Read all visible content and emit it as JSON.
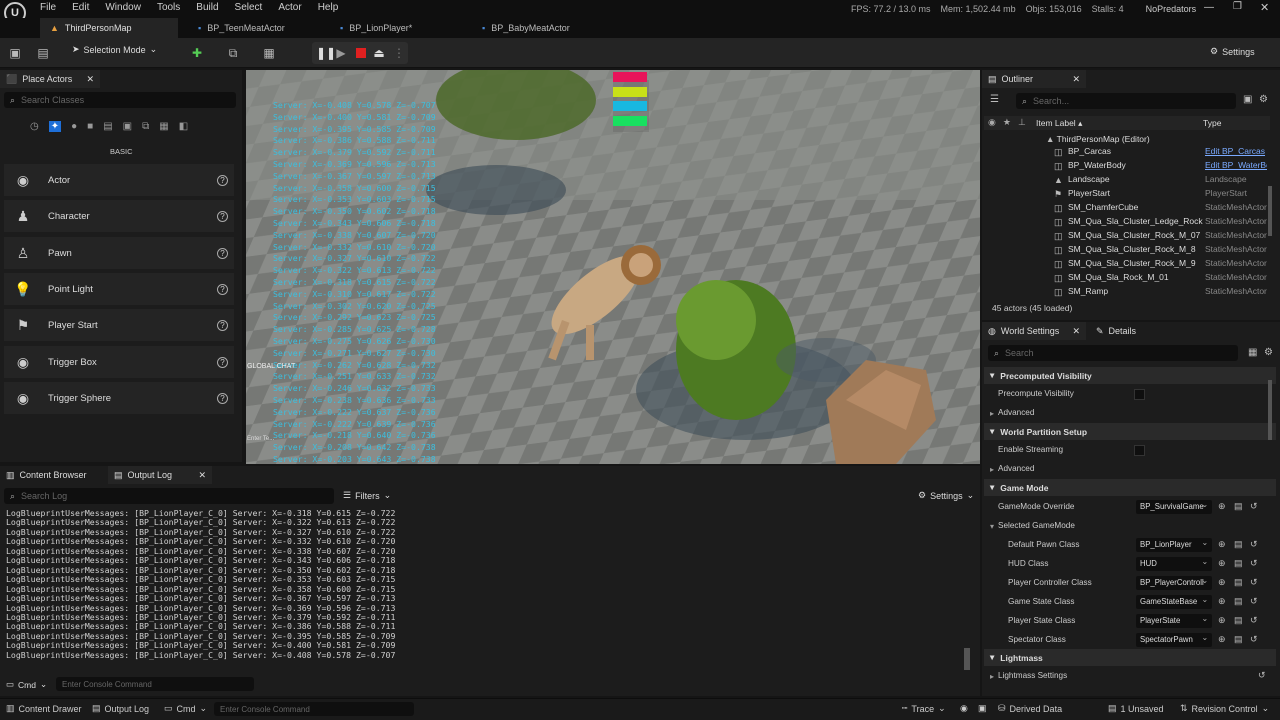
{
  "menu": [
    "File",
    "Edit",
    "Window",
    "Tools",
    "Build",
    "Select",
    "Actor",
    "Help"
  ],
  "stats": {
    "fps": "FPS: 77.2 / 13.0 ms",
    "mem": "Mem: 1,502.44 mb",
    "objs": "Objs: 153,016",
    "stalls": "Stalls: 4",
    "project": "NoPredators"
  },
  "tabs": [
    {
      "label": "ThirdPersonMap"
    },
    {
      "label": "BP_TeenMeatActor"
    },
    {
      "label": "BP_LionPlayer*"
    },
    {
      "label": "BP_BabyMeatActor"
    }
  ],
  "toolbar": {
    "mode": "Selection Mode",
    "settings": "Settings"
  },
  "place_actors": {
    "tab": "Place Actors",
    "search_placeholder": "Search Classes",
    "category": "BASIC",
    "items": [
      "Actor",
      "Character",
      "Pawn",
      "Point Light",
      "Player Start",
      "Trigger Box",
      "Trigger Sphere"
    ]
  },
  "viewport": {
    "overlay_lines": [
      "Server: X=-0.408 Y=0.578 Z=-0.707",
      "Server: X=-0.400 Y=0.581 Z=-0.709",
      "Server: X=-0.395 Y=0.585 Z=-0.709",
      "Server: X=-0.386 Y=0.588 Z=-0.711",
      "Server: X=-0.379 Y=0.592 Z=-0.711",
      "Server: X=-0.369 Y=0.596 Z=-0.713",
      "Server: X=-0.367 Y=0.597 Z=-0.713",
      "Server: X=-0.358 Y=0.600 Z=-0.715",
      "Server: X=-0.353 Y=0.603 Z=-0.715",
      "Server: X=-0.350 Y=0.602 Z=-0.718",
      "Server: X=-0.343 Y=0.606 Z=-0.718",
      "Server: X=-0.338 Y=0.607 Z=-0.720",
      "Server: X=-0.332 Y=0.610 Z=-0.720",
      "Server: X=-0.327 Y=0.610 Z=-0.722",
      "Server: X=-0.322 Y=0.613 Z=-0.722",
      "Server: X=-0.318 Y=0.615 Z=-0.722",
      "Server: X=-0.310 Y=0.617 Z=-0.722",
      "Server: X=-0.302 Y=0.620 Z=-0.725",
      "Server: X=-0.292 Y=0.623 Z=-0.725",
      "Server: X=-0.285 Y=0.625 Z=-0.728",
      "Server: X=-0.275 Y=0.626 Z=-0.730",
      "Server: X=-0.271 Y=0.627 Z=-0.730",
      "Server: X=-0.262 Y=0.628 Z=-0.732",
      "Server: X=-0.251 Y=0.633 Z=-0.732",
      "Server: X=-0.246 Y=0.632 Z=-0.733",
      "Server: X=-0.238 Y=0.636 Z=-0.733",
      "Server: X=-0.222 Y=0.637 Z=-0.736",
      "Server: X=-0.222 Y=0.639 Z=-0.736",
      "Server: X=-0.218 Y=0.640 Z=-0.736",
      "Server: X=-0.208 Y=0.642 Z=-0.738",
      "Server: X=-0.203 Y=0.643 Z=-0.738"
    ],
    "global_chat": "GLOBAL CHAT",
    "enter_text": "Enter Te...",
    "bars": [
      "#e8145a",
      "#c8e018",
      "#18b8e0",
      "#18e060"
    ]
  },
  "bottom_tabs": {
    "content_browser": "Content Browser",
    "output_log": "Output Log"
  },
  "log": {
    "search_placeholder": "Search Log",
    "filters": "Filters",
    "settings": "Settings",
    "lines": [
      "LogBlueprintUserMessages: [BP_LionPlayer_C_0] Server: X=-0.318 Y=0.615 Z=-0.722",
      "LogBlueprintUserMessages: [BP_LionPlayer_C_0] Server: X=-0.322 Y=0.613 Z=-0.722",
      "LogBlueprintUserMessages: [BP_LionPlayer_C_0] Server: X=-0.327 Y=0.610 Z=-0.722",
      "LogBlueprintUserMessages: [BP_LionPlayer_C_0] Server: X=-0.332 Y=0.610 Z=-0.720",
      "LogBlueprintUserMessages: [BP_LionPlayer_C_0] Server: X=-0.338 Y=0.607 Z=-0.720",
      "LogBlueprintUserMessages: [BP_LionPlayer_C_0] Server: X=-0.343 Y=0.606 Z=-0.718",
      "LogBlueprintUserMessages: [BP_LionPlayer_C_0] Server: X=-0.350 Y=0.602 Z=-0.718",
      "LogBlueprintUserMessages: [BP_LionPlayer_C_0] Server: X=-0.353 Y=0.603 Z=-0.715",
      "LogBlueprintUserMessages: [BP_LionPlayer_C_0] Server: X=-0.358 Y=0.600 Z=-0.715",
      "LogBlueprintUserMessages: [BP_LionPlayer_C_0] Server: X=-0.367 Y=0.597 Z=-0.713",
      "LogBlueprintUserMessages: [BP_LionPlayer_C_0] Server: X=-0.369 Y=0.596 Z=-0.713",
      "LogBlueprintUserMessages: [BP_LionPlayer_C_0] Server: X=-0.379 Y=0.592 Z=-0.711",
      "LogBlueprintUserMessages: [BP_LionPlayer_C_0] Server: X=-0.386 Y=0.588 Z=-0.711",
      "LogBlueprintUserMessages: [BP_LionPlayer_C_0] Server: X=-0.395 Y=0.585 Z=-0.709",
      "LogBlueprintUserMessages: [BP_LionPlayer_C_0] Server: X=-0.400 Y=0.581 Z=-0.709",
      "LogBlueprintUserMessages: [BP_LionPlayer_C_0] Server: X=-0.408 Y=0.578 Z=-0.707"
    ],
    "cmd": "Cmd",
    "console_placeholder": "Enter Console Command"
  },
  "outliner": {
    "tab": "Outliner",
    "search_placeholder": "Search...",
    "col_label": "Item Label",
    "col_type": "Type",
    "root": "ThirdPersonMap (Editor)",
    "rows": [
      {
        "name": "BP_Carcas",
        "type": "Edit BP_Carcas",
        "link": true
      },
      {
        "name": "BP_WaterBody",
        "type": "Edit BP_WaterBo",
        "link": true
      },
      {
        "name": "Landscape",
        "type": "Landscape",
        "link": false
      },
      {
        "name": "PlayerStart",
        "type": "PlayerStart",
        "link": false
      },
      {
        "name": "SM_ChamferCube",
        "type": "StaticMeshActor",
        "link": false
      },
      {
        "name": "SM_Qua_Sla_Cluster_Ledge_Rock",
        "type": "StaticMeshActor",
        "link": false
      },
      {
        "name": "SM_Qua_Sla_Cluster_Rock_M_07",
        "type": "StaticMeshActor",
        "link": false
      },
      {
        "name": "SM_Qua_Sla_Cluster_Rock_M_8",
        "type": "StaticMeshActor",
        "link": false
      },
      {
        "name": "SM_Qua_Sla_Cluster_Rock_M_9",
        "type": "StaticMeshActor",
        "link": false
      },
      {
        "name": "SM_Qua_Sla_Rock_M_01",
        "type": "StaticMeshActor",
        "link": false
      },
      {
        "name": "SM_Ramp",
        "type": "StaticMeshActor",
        "link": false
      }
    ],
    "count": "45 actors (45 loaded)"
  },
  "details": {
    "tab_world": "World Settings",
    "tab_details": "Details",
    "search_placeholder": "Search",
    "sections": {
      "precomputed": "Precomputed Visibility",
      "precompute_vis": "Precompute Visibility",
      "advanced1": "Advanced",
      "world_partition": "World Partition Setup",
      "enable_streaming": "Enable Streaming",
      "advanced2": "Advanced",
      "game_mode": "Game Mode",
      "gamemode_override": "GameMode Override",
      "gamemode_override_val": "BP_SurvivalGame",
      "selected_gamemode": "Selected GameMode",
      "lightmass": "Lightmass",
      "lightmass_settings": "Lightmass Settings"
    },
    "classes": [
      {
        "label": "Default Pawn Class",
        "value": "BP_LionPlayer"
      },
      {
        "label": "HUD Class",
        "value": "HUD"
      },
      {
        "label": "Player Controller Class",
        "value": "BP_PlayerControll"
      },
      {
        "label": "Game State Class",
        "value": "GameStateBase"
      },
      {
        "label": "Player State Class",
        "value": "PlayerState"
      },
      {
        "label": "Spectator Class",
        "value": "SpectatorPawn"
      }
    ]
  },
  "statusbar": {
    "content_drawer": "Content Drawer",
    "output_log": "Output Log",
    "cmd": "Cmd",
    "console_placeholder": "Enter Console Command",
    "trace": "Trace",
    "derived_data": "Derived Data",
    "unsaved": "1 Unsaved",
    "revision": "Revision Control"
  }
}
